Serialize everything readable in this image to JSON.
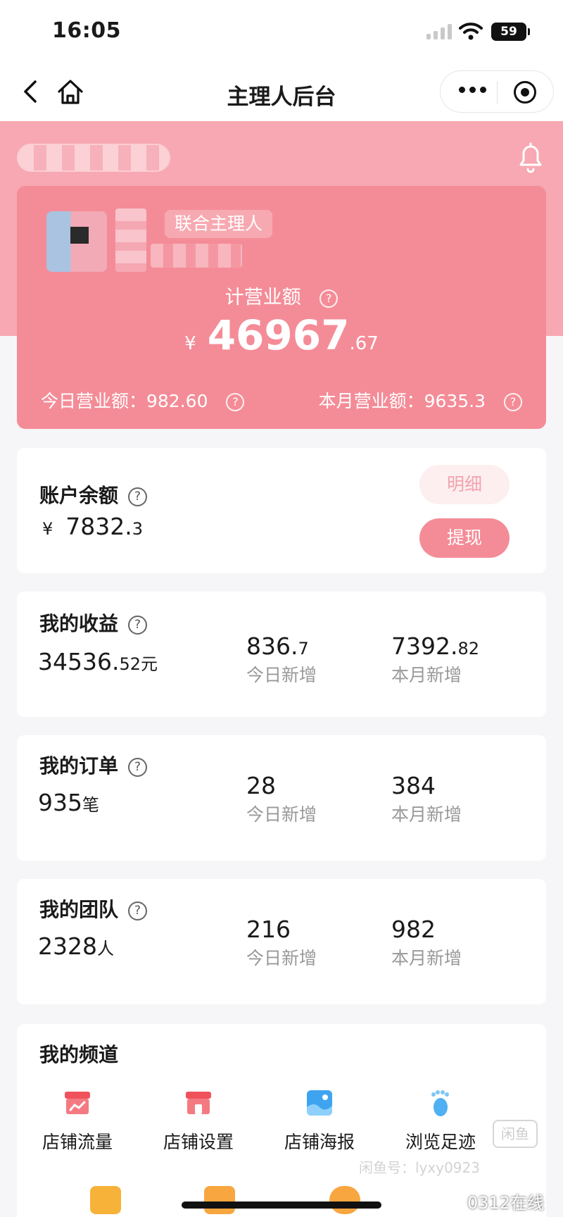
{
  "status_bar": {
    "time": "16:05",
    "battery": "59"
  },
  "nav": {
    "title": "主理人后台"
  },
  "profile": {
    "role": "联合主理人"
  },
  "revenue": {
    "label": "计营业额",
    "currency": "¥",
    "total_int": "46967",
    "total_dec": ".67",
    "today": "今日营业额：982.60",
    "month": "本月营业额：9635.3"
  },
  "balance": {
    "title": "账户余额",
    "currency": "¥",
    "value_int": "7832.",
    "value_dec": "3",
    "detail_button": "明细",
    "withdraw_button": "提现"
  },
  "earnings": {
    "title": "我的收益",
    "total_int": "34536.",
    "total_dec": "52元",
    "today_int": "836.",
    "today_dec": "7",
    "today_label": "今日新增",
    "month_int": "7392.",
    "month_dec": "82",
    "month_label": "本月新增"
  },
  "orders": {
    "title": "我的订单",
    "total": "935",
    "unit": "笔",
    "today": "28",
    "today_label": "今日新增",
    "month": "384",
    "month_label": "本月新增"
  },
  "team": {
    "title": "我的团队",
    "total": "2328",
    "unit": "人",
    "today": "216",
    "today_label": "今日新增",
    "month": "982",
    "month_label": "本月新增"
  },
  "channels": {
    "title": "我的频道",
    "items": [
      {
        "label": "店铺流量",
        "icon": "store-traffic-icon",
        "color": "#f0525c"
      },
      {
        "label": "店铺设置",
        "icon": "store-settings-icon",
        "color": "#f0525c"
      },
      {
        "label": "店铺海报",
        "icon": "poster-icon",
        "color": "#3fa4f0"
      },
      {
        "label": "浏览足迹",
        "icon": "footprint-icon",
        "color": "#4fb0f2"
      }
    ]
  },
  "watermark": {
    "line1": "闲鱼号：lyxy0923",
    "line2": "0312在线",
    "logo": "闲鱼"
  },
  "colors": {
    "brand_pink": "#f48c97",
    "header_pink": "#f7a8b2"
  }
}
